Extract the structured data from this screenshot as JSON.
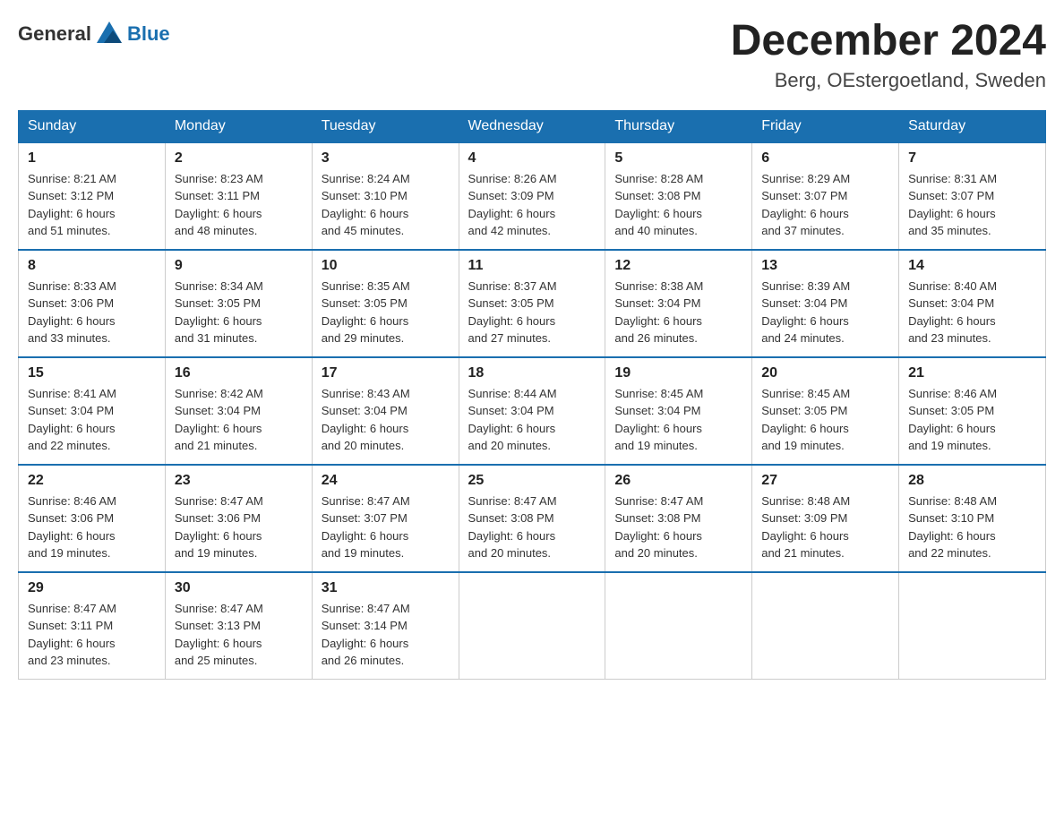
{
  "header": {
    "logo_general": "General",
    "logo_blue": "Blue",
    "month_title": "December 2024",
    "location": "Berg, OEstergoetland, Sweden"
  },
  "weekdays": [
    "Sunday",
    "Monday",
    "Tuesday",
    "Wednesday",
    "Thursday",
    "Friday",
    "Saturday"
  ],
  "weeks": [
    [
      {
        "day": "1",
        "sunrise": "8:21 AM",
        "sunset": "3:12 PM",
        "daylight": "6 hours and 51 minutes."
      },
      {
        "day": "2",
        "sunrise": "8:23 AM",
        "sunset": "3:11 PM",
        "daylight": "6 hours and 48 minutes."
      },
      {
        "day": "3",
        "sunrise": "8:24 AM",
        "sunset": "3:10 PM",
        "daylight": "6 hours and 45 minutes."
      },
      {
        "day": "4",
        "sunrise": "8:26 AM",
        "sunset": "3:09 PM",
        "daylight": "6 hours and 42 minutes."
      },
      {
        "day": "5",
        "sunrise": "8:28 AM",
        "sunset": "3:08 PM",
        "daylight": "6 hours and 40 minutes."
      },
      {
        "day": "6",
        "sunrise": "8:29 AM",
        "sunset": "3:07 PM",
        "daylight": "6 hours and 37 minutes."
      },
      {
        "day": "7",
        "sunrise": "8:31 AM",
        "sunset": "3:07 PM",
        "daylight": "6 hours and 35 minutes."
      }
    ],
    [
      {
        "day": "8",
        "sunrise": "8:33 AM",
        "sunset": "3:06 PM",
        "daylight": "6 hours and 33 minutes."
      },
      {
        "day": "9",
        "sunrise": "8:34 AM",
        "sunset": "3:05 PM",
        "daylight": "6 hours and 31 minutes."
      },
      {
        "day": "10",
        "sunrise": "8:35 AM",
        "sunset": "3:05 PM",
        "daylight": "6 hours and 29 minutes."
      },
      {
        "day": "11",
        "sunrise": "8:37 AM",
        "sunset": "3:05 PM",
        "daylight": "6 hours and 27 minutes."
      },
      {
        "day": "12",
        "sunrise": "8:38 AM",
        "sunset": "3:04 PM",
        "daylight": "6 hours and 26 minutes."
      },
      {
        "day": "13",
        "sunrise": "8:39 AM",
        "sunset": "3:04 PM",
        "daylight": "6 hours and 24 minutes."
      },
      {
        "day": "14",
        "sunrise": "8:40 AM",
        "sunset": "3:04 PM",
        "daylight": "6 hours and 23 minutes."
      }
    ],
    [
      {
        "day": "15",
        "sunrise": "8:41 AM",
        "sunset": "3:04 PM",
        "daylight": "6 hours and 22 minutes."
      },
      {
        "day": "16",
        "sunrise": "8:42 AM",
        "sunset": "3:04 PM",
        "daylight": "6 hours and 21 minutes."
      },
      {
        "day": "17",
        "sunrise": "8:43 AM",
        "sunset": "3:04 PM",
        "daylight": "6 hours and 20 minutes."
      },
      {
        "day": "18",
        "sunrise": "8:44 AM",
        "sunset": "3:04 PM",
        "daylight": "6 hours and 20 minutes."
      },
      {
        "day": "19",
        "sunrise": "8:45 AM",
        "sunset": "3:04 PM",
        "daylight": "6 hours and 19 minutes."
      },
      {
        "day": "20",
        "sunrise": "8:45 AM",
        "sunset": "3:05 PM",
        "daylight": "6 hours and 19 minutes."
      },
      {
        "day": "21",
        "sunrise": "8:46 AM",
        "sunset": "3:05 PM",
        "daylight": "6 hours and 19 minutes."
      }
    ],
    [
      {
        "day": "22",
        "sunrise": "8:46 AM",
        "sunset": "3:06 PM",
        "daylight": "6 hours and 19 minutes."
      },
      {
        "day": "23",
        "sunrise": "8:47 AM",
        "sunset": "3:06 PM",
        "daylight": "6 hours and 19 minutes."
      },
      {
        "day": "24",
        "sunrise": "8:47 AM",
        "sunset": "3:07 PM",
        "daylight": "6 hours and 19 minutes."
      },
      {
        "day": "25",
        "sunrise": "8:47 AM",
        "sunset": "3:08 PM",
        "daylight": "6 hours and 20 minutes."
      },
      {
        "day": "26",
        "sunrise": "8:47 AM",
        "sunset": "3:08 PM",
        "daylight": "6 hours and 20 minutes."
      },
      {
        "day": "27",
        "sunrise": "8:48 AM",
        "sunset": "3:09 PM",
        "daylight": "6 hours and 21 minutes."
      },
      {
        "day": "28",
        "sunrise": "8:48 AM",
        "sunset": "3:10 PM",
        "daylight": "6 hours and 22 minutes."
      }
    ],
    [
      {
        "day": "29",
        "sunrise": "8:47 AM",
        "sunset": "3:11 PM",
        "daylight": "6 hours and 23 minutes."
      },
      {
        "day": "30",
        "sunrise": "8:47 AM",
        "sunset": "3:13 PM",
        "daylight": "6 hours and 25 minutes."
      },
      {
        "day": "31",
        "sunrise": "8:47 AM",
        "sunset": "3:14 PM",
        "daylight": "6 hours and 26 minutes."
      },
      null,
      null,
      null,
      null
    ]
  ],
  "labels": {
    "sunrise": "Sunrise:",
    "sunset": "Sunset:",
    "daylight": "Daylight:"
  }
}
